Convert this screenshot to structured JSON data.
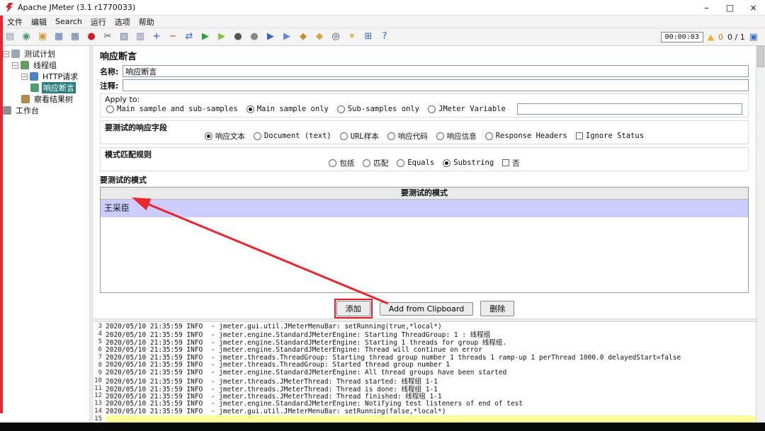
{
  "window": {
    "title": "Apache JMeter (3.1 r1770033)",
    "controls": {
      "minimize": "–",
      "maximize": "□",
      "close": "×"
    }
  },
  "menubar": {
    "items": [
      {
        "key": "file",
        "label": "文件"
      },
      {
        "key": "edit",
        "label": "编辑"
      },
      {
        "key": "search",
        "label": "Search"
      },
      {
        "key": "run",
        "label": "运行"
      },
      {
        "key": "options",
        "label": "选项"
      },
      {
        "key": "help",
        "label": "帮助"
      }
    ]
  },
  "toolbar": {
    "icons": [
      {
        "key": "new-file",
        "glyph": "▤",
        "color": "#8a93a0"
      },
      {
        "key": "templates",
        "glyph": "◉",
        "color": "#3f9b6e"
      },
      {
        "key": "open-file",
        "glyph": "▣",
        "color": "#d99a3d"
      },
      {
        "key": "save",
        "glyph": "▦",
        "color": "#5577aa"
      },
      {
        "key": "save-as",
        "glyph": "▦",
        "color": "#5577aa"
      },
      {
        "key": "record",
        "glyph": "●",
        "color": "#cc2222"
      },
      {
        "key": "cut",
        "glyph": "✂",
        "color": "#555555"
      },
      {
        "key": "copy",
        "glyph": "▧",
        "color": "#557799"
      },
      {
        "key": "paste",
        "glyph": "▥",
        "color": "#8877aa"
      },
      {
        "key": "expand-all",
        "glyph": "+",
        "color": "#2255cc"
      },
      {
        "key": "collapse-all",
        "glyph": "−",
        "color": "#cc4444"
      },
      {
        "key": "toggle",
        "glyph": "⇄",
        "color": "#3366bb"
      },
      {
        "key": "start",
        "glyph": "▶",
        "color": "#2e9e3a"
      },
      {
        "key": "start-no-timers",
        "glyph": "▶",
        "color": "#7fc24a"
      },
      {
        "key": "stop",
        "glyph": "●",
        "color": "#555555"
      },
      {
        "key": "shutdown",
        "glyph": "●",
        "color": "#888888"
      },
      {
        "key": "remote-start-all",
        "glyph": "▶",
        "color": "#3366bb"
      },
      {
        "key": "remote-shutdown-all",
        "glyph": "▶",
        "color": "#6688cc"
      },
      {
        "key": "clear",
        "glyph": "◆",
        "color": "#c98a2e"
      },
      {
        "key": "clear-all",
        "glyph": "◆",
        "color": "#d9a43e"
      },
      {
        "key": "search",
        "glyph": "◎",
        "color": "#334466"
      },
      {
        "key": "search-reset",
        "glyph": "✶",
        "color": "#c9b22e"
      },
      {
        "key": "function-helper",
        "glyph": "⊞",
        "color": "#3366bb"
      },
      {
        "key": "help",
        "glyph": "?",
        "color": "#3366bb"
      }
    ],
    "timer": "00:00:03",
    "warning_count": "0",
    "thread_count": "0 / 1"
  },
  "tree": {
    "items": [
      {
        "key": "test-plan",
        "label": "测试计划",
        "indent": 0,
        "handle": true,
        "icon_color": "#9aa7b8",
        "selected": false
      },
      {
        "key": "thread-group",
        "label": "线程组",
        "indent": 1,
        "handle": true,
        "icon_color": "#5f9e5f",
        "selected": false
      },
      {
        "key": "http-request",
        "label": "HTTP请求",
        "indent": 2,
        "handle": true,
        "icon_color": "#4a84c4",
        "selected": false
      },
      {
        "key": "response-assertion",
        "label": "响应断言",
        "indent": 3,
        "handle": false,
        "icon_color": "#49a06a",
        "selected": true
      },
      {
        "key": "view-results-tree",
        "label": "察看结果树",
        "indent": 2,
        "handle": false,
        "icon_color": "#b08a4f",
        "selected": false
      },
      {
        "key": "workbench",
        "label": "工作台",
        "indent": 0,
        "handle": false,
        "icon_color": "#8a8f98",
        "selected": false
      }
    ]
  },
  "main": {
    "title": "响应断言",
    "fields": {
      "name_label": "名称:",
      "name_value": "响应断言",
      "comment_label": "注释:",
      "comment_value": ""
    },
    "apply_to": {
      "title": "Apply to:",
      "options": [
        {
          "label": "Main sample and sub-samples",
          "selected": false
        },
        {
          "label": "Main sample only",
          "selected": true
        },
        {
          "label": "Sub-samples only",
          "selected": false
        },
        {
          "label": "JMeter Variable",
          "selected": false
        }
      ],
      "variable_value": ""
    },
    "response_field": {
      "title": "要测试的响应字段",
      "options": [
        {
          "label": "响应文本",
          "selected": true
        },
        {
          "label": "Document (text)",
          "selected": false
        },
        {
          "label": "URL样本",
          "selected": false
        },
        {
          "label": "响应代码",
          "selected": false
        },
        {
          "label": "响应信息",
          "selected": false
        },
        {
          "label": "Response Headers",
          "selected": false
        }
      ],
      "checkbox": {
        "label": "Ignore Status",
        "checked": false
      }
    },
    "pattern_rules": {
      "title": "模式匹配规则",
      "options": [
        {
          "label": "包括",
          "selected": false
        },
        {
          "label": "匹配",
          "selected": false
        },
        {
          "label": "Equals",
          "selected": false
        },
        {
          "label": "Substring",
          "selected": true
        }
      ],
      "checkbox": {
        "label": "否",
        "checked": false
      }
    },
    "patterns": {
      "title": "要测试的模式",
      "table_header": "要测试的模式",
      "rows": [
        {
          "value": "王采臣",
          "selected": true
        }
      ]
    },
    "buttons": [
      {
        "key": "add",
        "label": "添加",
        "annotated": true
      },
      {
        "key": "add-from-clipboard",
        "label": "Add from Clipboard",
        "annotated": false
      },
      {
        "key": "delete",
        "label": "删除",
        "annotated": false
      }
    ]
  },
  "log": {
    "lines": [
      {
        "num": "3",
        "text": "2020/05/10 21:35:59 INFO  - jmeter.gui.util.JMeterMenuBar: setRunning(true,*local*)",
        "highlight": false
      },
      {
        "num": "4",
        "text": "2020/05/10 21:35:59 INFO  - jmeter.engine.StandardJMeterEngine: Starting ThreadGroup: 1 : 线程组",
        "highlight": false
      },
      {
        "num": "5",
        "text": "2020/05/10 21:35:59 INFO  - jmeter.engine.StandardJMeterEngine: Starting 1 threads for group 线程组.",
        "highlight": false
      },
      {
        "num": "6",
        "text": "2020/05/10 21:35:59 INFO  - jmeter.engine.StandardJMeterEngine: Thread will continue on error",
        "highlight": false
      },
      {
        "num": "7",
        "text": "2020/05/10 21:35:59 INFO  - jmeter.threads.ThreadGroup: Starting thread group number 1 threads 1 ramp-up 1 perThread 1000.0 delayedStart=false",
        "highlight": false
      },
      {
        "num": "8",
        "text": "2020/05/10 21:35:59 INFO  - jmeter.threads.ThreadGroup: Started thread group number 1",
        "highlight": false
      },
      {
        "num": "9",
        "text": "2020/05/10 21:35:59 INFO  - jmeter.engine.StandardJMeterEngine: All thread groups have been started",
        "highlight": false
      },
      {
        "num": "10",
        "text": "2020/05/10 21:35:59 INFO  - jmeter.threads.JMeterThread: Thread started: 线程组 1-1",
        "highlight": false
      },
      {
        "num": "11",
        "text": "2020/05/10 21:35:59 INFO  - jmeter.threads.JMeterThread: Thread is done: 线程组 1-1",
        "highlight": false
      },
      {
        "num": "12",
        "text": "2020/05/10 21:35:59 INFO  - jmeter.threads.JMeterThread: Thread finished: 线程组 1-1",
        "highlight": false
      },
      {
        "num": "13",
        "text": "2020/05/10 21:35:59 INFO  - jmeter.engine.StandardJMeterEngine: Notifying test listeners of end of test",
        "highlight": false
      },
      {
        "num": "14",
        "text": "2020/05/10 21:35:59 INFO  - jmeter.gui.util.JMeterMenuBar: setRunning(false,*local*)",
        "highlight": false
      },
      {
        "num": "15",
        "text": "",
        "highlight": true
      }
    ]
  },
  "colors": {
    "tree_selection": "#2e7d7f",
    "pattern_row_selection": "#ccccfe",
    "log_highlight": "#ffff99",
    "annotation_red": "#ed1c24"
  },
  "annotations": {
    "arrow_from": "add-button",
    "arrow_to": "pattern-row",
    "box_around": "add-button"
  }
}
